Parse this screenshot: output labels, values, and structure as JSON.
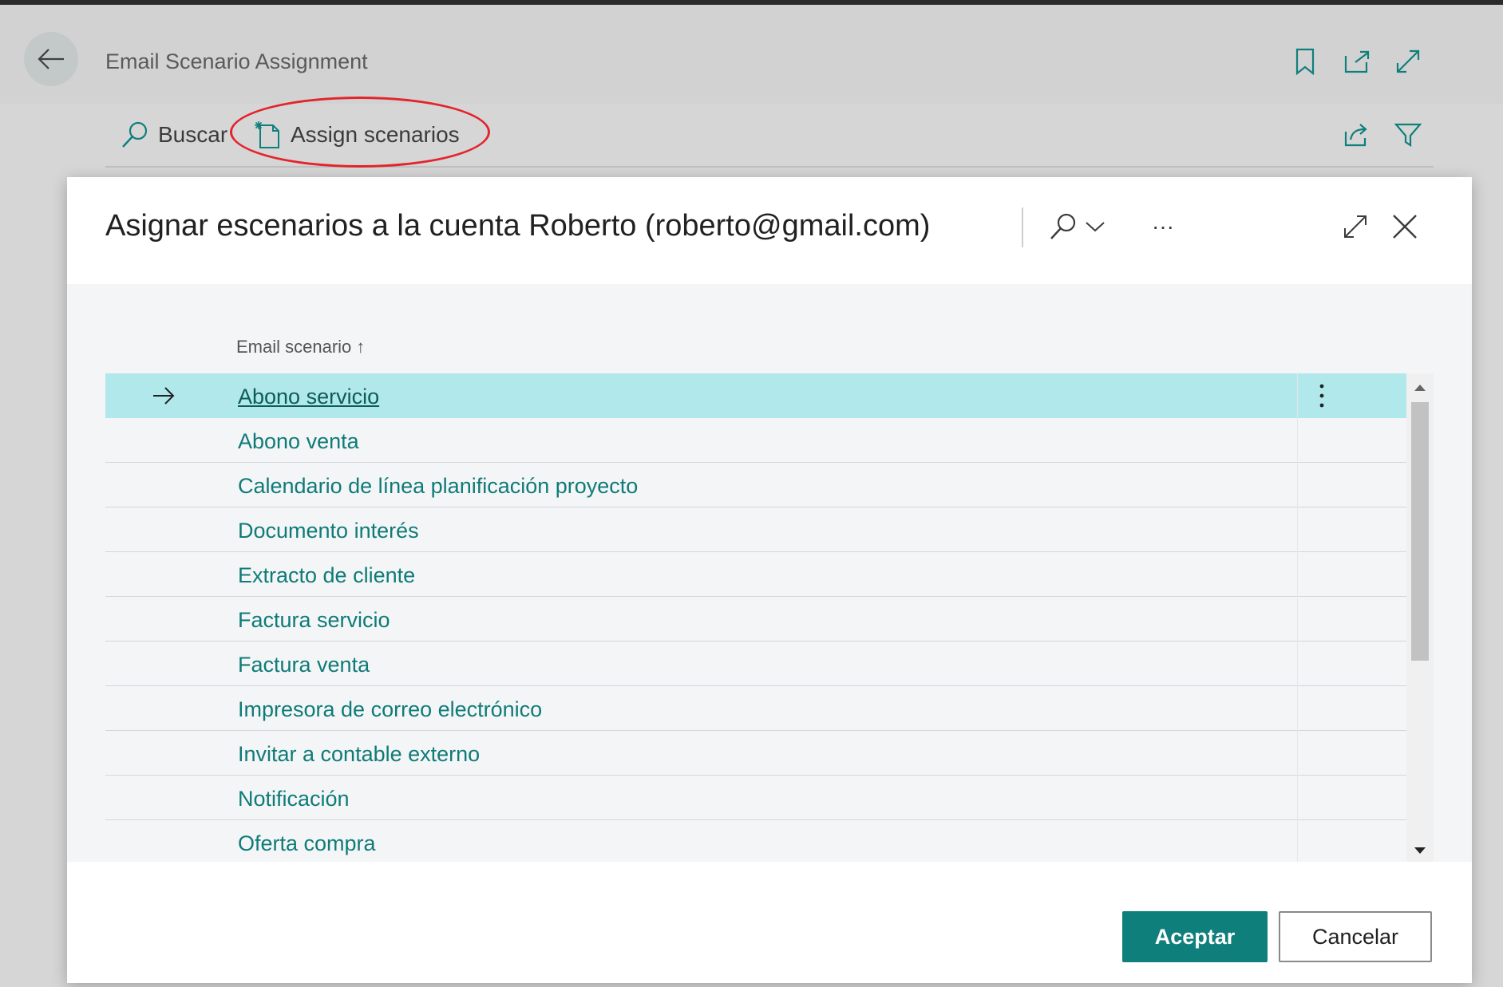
{
  "page": {
    "title": "Email Scenario Assignment",
    "icons": [
      "back-arrow-icon",
      "bookmark-icon",
      "open-in-new-window-icon",
      "expand-icon"
    ]
  },
  "action_bar": {
    "search_label": "Buscar",
    "assign_label": "Assign scenarios",
    "icons": [
      "search-icon",
      "new-document-icon",
      "share-icon",
      "filter-icon"
    ]
  },
  "colors": {
    "accent": "#0f7f7c",
    "link": "#0f7b78",
    "selected_row": "#b1e8eb",
    "annotation": "#e3242b"
  },
  "dialog": {
    "title": "Asignar escenarios a la cuenta Roberto (roberto@gmail.com)",
    "more_label": "···",
    "column_header": "Email scenario",
    "sort_indicator": "↑",
    "rows": [
      {
        "label": "Abono servicio",
        "selected": true
      },
      {
        "label": "Abono venta"
      },
      {
        "label": "Calendario de línea planificación proyecto"
      },
      {
        "label": "Documento interés"
      },
      {
        "label": "Extracto de cliente"
      },
      {
        "label": "Factura servicio"
      },
      {
        "label": "Factura venta"
      },
      {
        "label": "Impresora de correo electrónico"
      },
      {
        "label": "Invitar a contable externo"
      },
      {
        "label": "Notificación"
      },
      {
        "label": "Oferta compra"
      }
    ],
    "ok_label": "Aceptar",
    "cancel_label": "Cancelar"
  }
}
